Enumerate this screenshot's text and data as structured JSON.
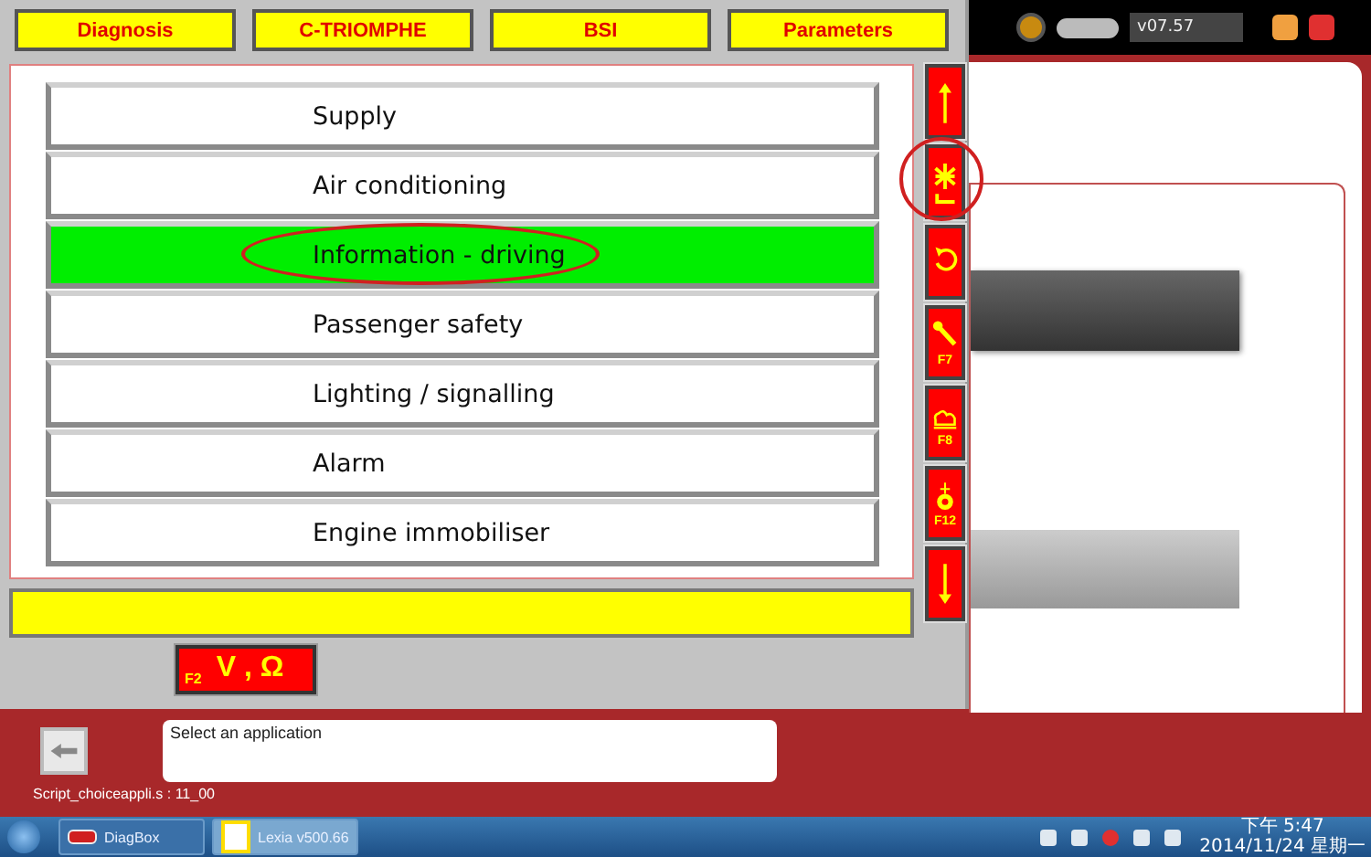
{
  "top_buttons": [
    {
      "label": "Diagnosis"
    },
    {
      "label": "C-TRIOMPHE"
    },
    {
      "label": "BSI"
    },
    {
      "label": "Parameters"
    }
  ],
  "toolbar": {
    "version": "v07.57"
  },
  "menu_items": [
    {
      "label": "Supply",
      "selected": false,
      "circled": false
    },
    {
      "label": "Air conditioning",
      "selected": false,
      "circled": false
    },
    {
      "label": "Information - driving",
      "selected": true,
      "circled": true
    },
    {
      "label": "Passenger safety",
      "selected": false,
      "circled": false
    },
    {
      "label": "Lighting / signalling",
      "selected": false,
      "circled": false
    },
    {
      "label": "Alarm",
      "selected": false,
      "circled": false
    },
    {
      "label": "Engine immobiliser",
      "selected": false,
      "circled": false
    }
  ],
  "side_buttons": [
    {
      "kind": "arrow-up",
      "circled": false
    },
    {
      "kind": "asterisk",
      "circled": true
    },
    {
      "kind": "undo",
      "circled": false
    },
    {
      "kind": "wrench",
      "key": "F7",
      "circled": false
    },
    {
      "kind": "cloud",
      "key": "F8",
      "circled": false
    },
    {
      "kind": "tower",
      "key": "F12",
      "circled": false
    },
    {
      "kind": "arrow-down",
      "circled": false
    }
  ],
  "measure_button": {
    "key": "F2",
    "label": "V , Ω"
  },
  "status": {
    "message": "Select an application",
    "script": "Script_choiceappli.s : 11_00"
  },
  "taskbar": {
    "items": [
      {
        "label": "DiagBox",
        "selected": false
      },
      {
        "label": "Lexia v500.66",
        "selected": true
      }
    ],
    "time": "下午 5:47",
    "date": "2014/11/24 星期一"
  }
}
